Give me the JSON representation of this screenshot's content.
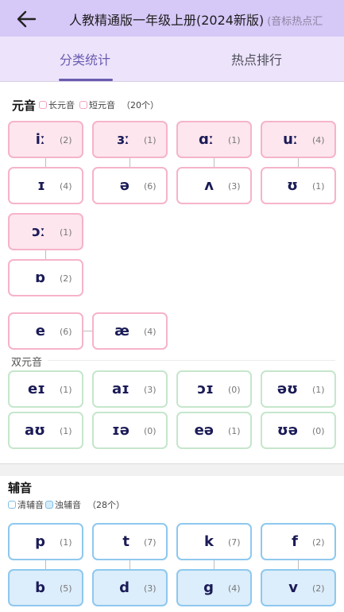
{
  "header": {
    "title": "人教精通版一年级上册(2024新版)",
    "title_sub": "(音标热点汇"
  },
  "tabs": [
    {
      "label": "分类统计"
    },
    {
      "label": "热点排行"
    }
  ],
  "vowels": {
    "title": "元音",
    "legend_long": "长元音",
    "legend_short": "短元音",
    "count_text": "（20个）",
    "cards": [
      {
        "symbol": "iː",
        "count": "(2)"
      },
      {
        "symbol": "ɜː",
        "count": "(1)"
      },
      {
        "symbol": "ɑː",
        "count": "(1)"
      },
      {
        "symbol": "uː",
        "count": "(4)"
      },
      {
        "symbol": "ɪ",
        "count": "(4)"
      },
      {
        "symbol": "ə",
        "count": "(6)"
      },
      {
        "symbol": "ʌ",
        "count": "(3)"
      },
      {
        "symbol": "ʊ",
        "count": "(1)"
      },
      {
        "symbol": "ɔː",
        "count": "(1)"
      },
      {
        "symbol": "ɒ",
        "count": "(2)"
      },
      {
        "symbol": "e",
        "count": "(6)"
      },
      {
        "symbol": "æ",
        "count": "(4)"
      }
    ],
    "diphthong_label": "双元音",
    "diphthongs": [
      {
        "symbol": "eɪ",
        "count": "(1)"
      },
      {
        "symbol": "aɪ",
        "count": "(3)"
      },
      {
        "symbol": "ɔɪ",
        "count": "(0)"
      },
      {
        "symbol": "əʊ",
        "count": "(1)"
      },
      {
        "symbol": "aʊ",
        "count": "(1)"
      },
      {
        "symbol": "ɪə",
        "count": "(0)"
      },
      {
        "symbol": "eə",
        "count": "(1)"
      },
      {
        "symbol": "ʊə",
        "count": "(0)"
      }
    ]
  },
  "consonants": {
    "title": "辅音",
    "legend_voiceless": "清辅音",
    "legend_voiced": "浊辅音",
    "count_text": "（28个）",
    "cards": [
      {
        "symbol": "p",
        "count": "(1)"
      },
      {
        "symbol": "t",
        "count": "(7)"
      },
      {
        "symbol": "k",
        "count": "(7)"
      },
      {
        "symbol": "f",
        "count": "(2)"
      },
      {
        "symbol": "b",
        "count": "(5)"
      },
      {
        "symbol": "d",
        "count": "(3)"
      },
      {
        "symbol": "g",
        "count": "(4)"
      },
      {
        "symbol": "v",
        "count": "(2)"
      }
    ]
  },
  "colors": {
    "header_bg": "#d6c8f7",
    "tab_bg": "#ede4fb",
    "accent": "#6a5bb0",
    "long_vowel": "#fde6ee",
    "vowel_border": "#f6b3cb",
    "diphthong_border": "#c6e6cc",
    "consonant_border": "#8ec8ee",
    "voiced_fill": "#dcedfb"
  }
}
